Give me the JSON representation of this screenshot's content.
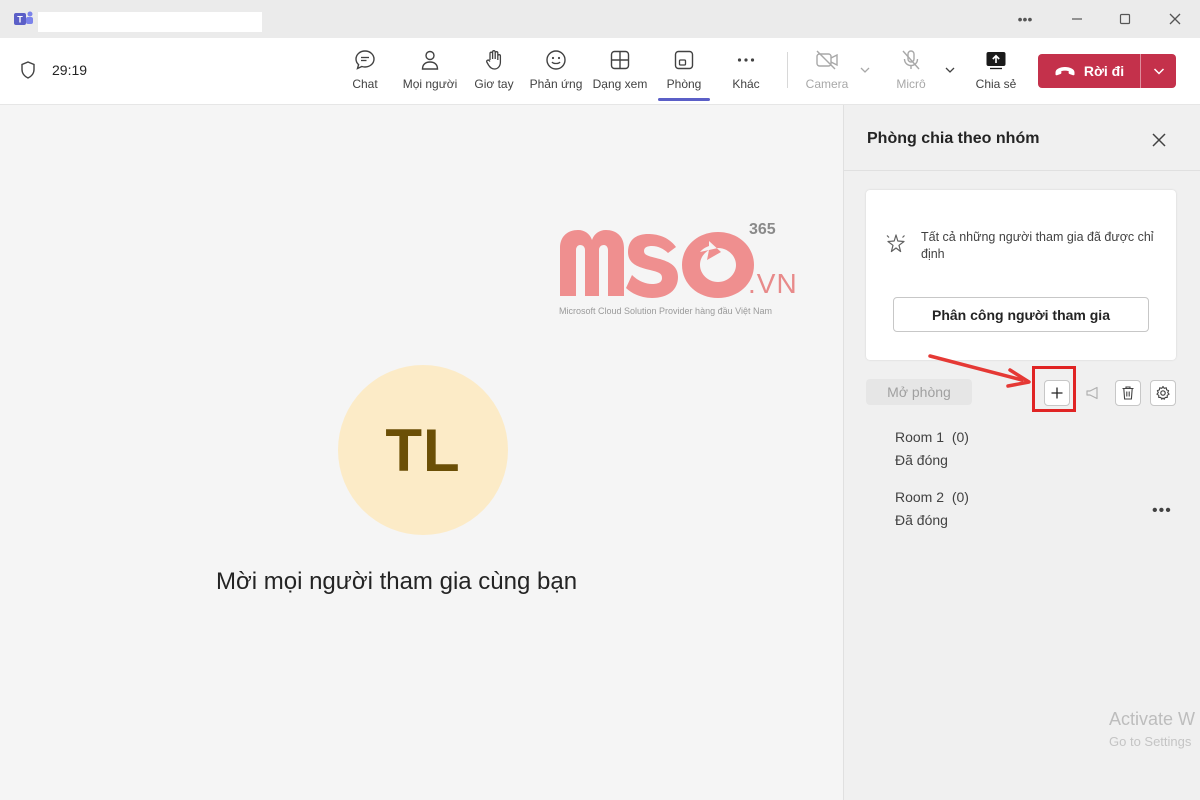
{
  "window": {
    "title": ""
  },
  "meeting": {
    "timer": "29:19"
  },
  "toolbar": {
    "items": [
      {
        "label": "Chat",
        "icon": "chat-icon"
      },
      {
        "label": "Mọi người",
        "icon": "people-icon"
      },
      {
        "label": "Giơ tay",
        "icon": "raise-hand-icon"
      },
      {
        "label": "Phản ứng",
        "icon": "reaction-icon"
      },
      {
        "label": "Dạng xem",
        "icon": "view-icon"
      },
      {
        "label": "Phòng",
        "icon": "rooms-icon",
        "active": true
      },
      {
        "label": "Khác",
        "icon": "more-icon"
      },
      {
        "label": "Camera",
        "icon": "camera-off-icon",
        "disabled": true
      },
      {
        "label": "Micrô",
        "icon": "mic-off-icon",
        "disabled": true
      },
      {
        "label": "Chia sẻ",
        "icon": "share-icon"
      }
    ],
    "leave_label": "Rời đi"
  },
  "stage": {
    "avatar_initials": "TL",
    "invite_text": "Mời mọi người tham gia cùng bạn"
  },
  "watermark": {
    "brand": "MSO",
    "domain": ".VN",
    "badge": "365",
    "tagline": "Microsoft Cloud Solution Provider hàng đầu Việt Nam"
  },
  "panel": {
    "title": "Phòng chia theo nhóm",
    "card_text": "Tất cả những người tham gia đã được chỉ định",
    "assign_button": "Phân công người tham gia",
    "open_rooms_button": "Mở phòng",
    "rooms": [
      {
        "name": "Room 1",
        "count": "(0)",
        "status": "Đã đóng"
      },
      {
        "name": "Room 2",
        "count": "(0)",
        "status": "Đã đóng"
      }
    ]
  },
  "system": {
    "activate_title": "Activate W",
    "activate_sub": "Go to Settings"
  },
  "colors": {
    "accent": "#5b5fc7",
    "leave": "#c4314b",
    "highlight": "#e02424"
  }
}
